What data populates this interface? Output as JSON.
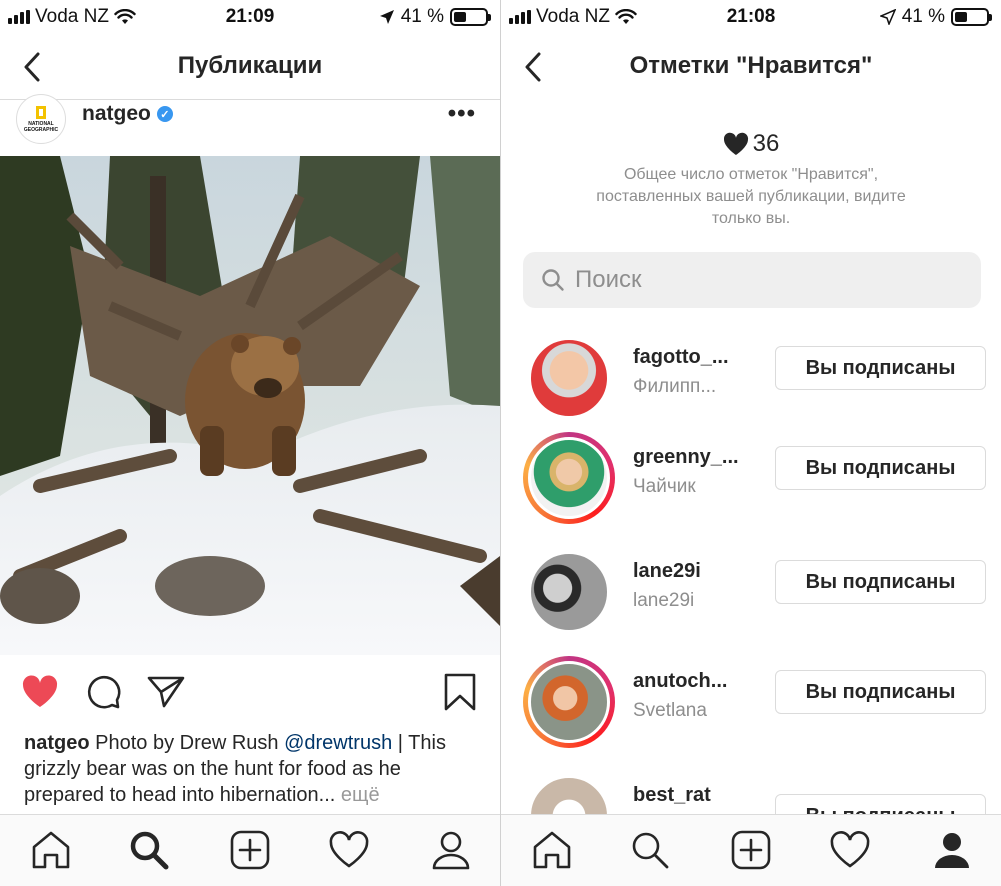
{
  "left": {
    "status": {
      "carrier": "Voda NZ",
      "time": "21:09",
      "battery": "41 %"
    },
    "nav": {
      "title": "Публикации"
    },
    "post": {
      "logo_text": "NATIONAL GEOGRAPHIC",
      "username": "natgeo",
      "more": "•••",
      "caption_user": "natgeo",
      "caption_text": " Photo by Drew Rush ",
      "caption_mention": "@drewtrush",
      "caption_rest": " | This grizzly bear was on the hunt for food as he prepared to head into hibernation...",
      "caption_more": " ещё",
      "liked": true
    },
    "tabs": [
      "home-icon",
      "search-icon",
      "add-icon",
      "heart-icon",
      "profile-icon"
    ],
    "active_tab": "search"
  },
  "right": {
    "status": {
      "carrier": "Voda NZ",
      "time": "21:08",
      "battery": "41 %"
    },
    "nav": {
      "title": "Отметки \"Нравится\""
    },
    "likes": {
      "count": "36",
      "note": "Общее число отметок \"Нравится\", поставленных вашей публикации, видите только вы."
    },
    "search": {
      "placeholder": "Поиск"
    },
    "likers": [
      {
        "username": "fagotto_...",
        "name": "Филипп...",
        "button": "Вы подписаны"
      },
      {
        "username": "greenny_...",
        "name": "Чайчик",
        "button": "Вы подписаны"
      },
      {
        "username": "lane29i",
        "name": "lane29i",
        "button": "Вы подписаны"
      },
      {
        "username": "anutoch...",
        "name": "Svetlana",
        "button": "Вы подписаны"
      },
      {
        "username": "best_rat",
        "name": "",
        "button": "Вы подписаны"
      }
    ],
    "tabs": [
      "home-icon",
      "search-icon",
      "add-icon",
      "heart-icon",
      "profile-icon"
    ],
    "active_tab": "profile"
  },
  "colors": {
    "like_red": "#ed4956",
    "verified_blue": "#3897f0",
    "mention": "#003569",
    "muted": "#8e8e8e"
  }
}
